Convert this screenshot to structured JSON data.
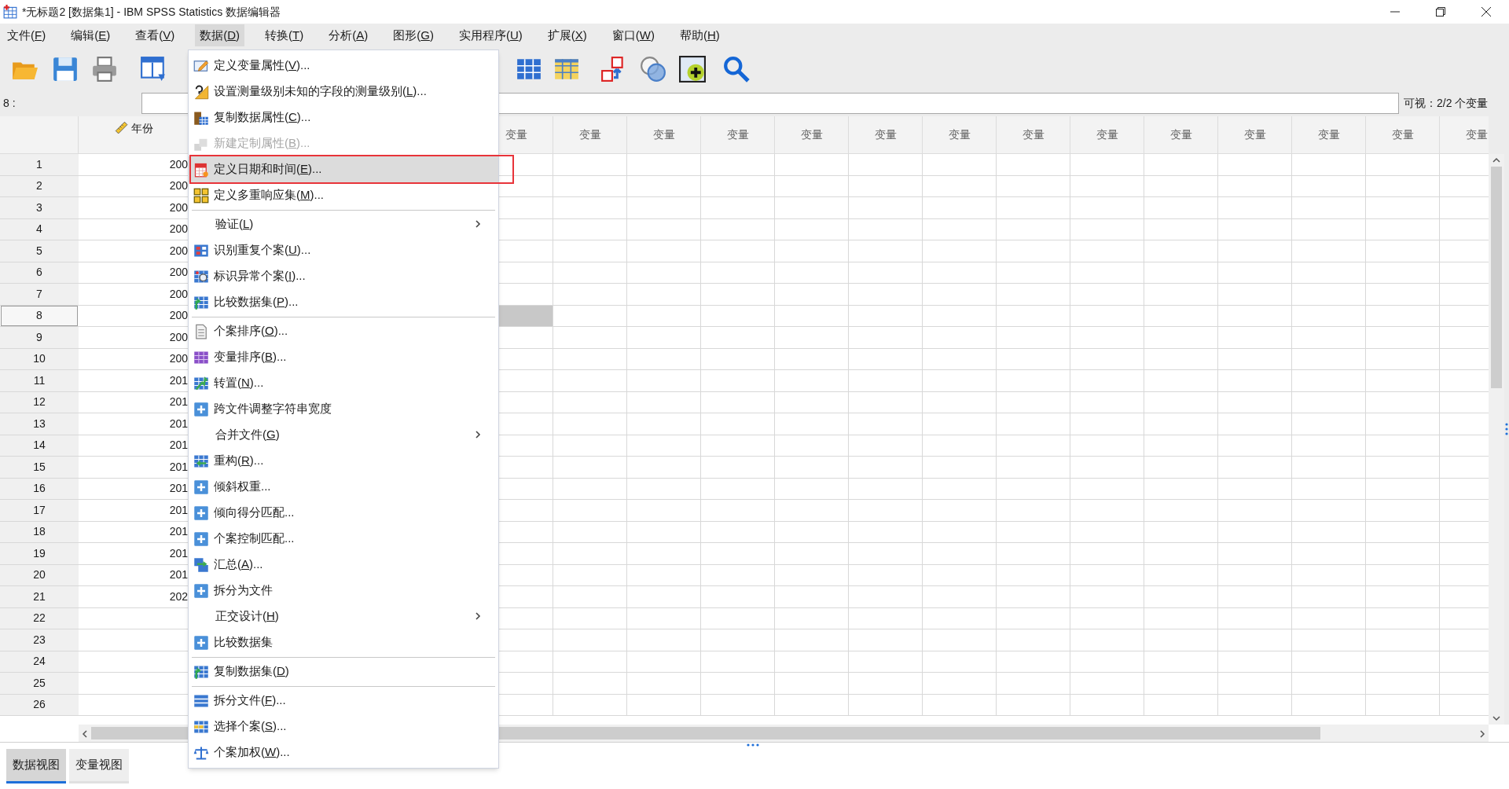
{
  "window": {
    "title": "*无标题2 [数据集1] - IBM SPSS Statistics 数据编辑器"
  },
  "menu_bar": [
    {
      "label": "文件(F)",
      "selected": false
    },
    {
      "label": "编辑(E)",
      "selected": false
    },
    {
      "label": "查看(V)",
      "selected": false
    },
    {
      "label": "数据(D)",
      "selected": true
    },
    {
      "label": "转换(T)",
      "selected": false
    },
    {
      "label": "分析(A)",
      "selected": false
    },
    {
      "label": "图形(G)",
      "selected": false
    },
    {
      "label": "实用程序(U)",
      "selected": false
    },
    {
      "label": "扩展(X)",
      "selected": false
    },
    {
      "label": "窗口(W)",
      "selected": false
    },
    {
      "label": "帮助(H)",
      "selected": false
    }
  ],
  "cell_editor": {
    "row_label": "8 :",
    "visible_count": "可视：2/2 个变量"
  },
  "grid": {
    "year_column": "年份",
    "variable_columns": [
      "变量",
      "变量",
      "变量",
      "变量",
      "变量",
      "变量",
      "变量",
      "变量",
      "变量",
      "变量",
      "变量",
      "变量",
      "变量",
      "变量"
    ],
    "rows": [
      {
        "number": "1",
        "year": "200",
        "selected": false
      },
      {
        "number": "2",
        "year": "200",
        "selected": false
      },
      {
        "number": "3",
        "year": "200",
        "selected": false
      },
      {
        "number": "4",
        "year": "200",
        "selected": false
      },
      {
        "number": "5",
        "year": "200",
        "selected": false
      },
      {
        "number": "6",
        "year": "200",
        "selected": false
      },
      {
        "number": "7",
        "year": "200",
        "selected": false
      },
      {
        "number": "8",
        "year": "200",
        "selected": true
      },
      {
        "number": "9",
        "year": "200",
        "selected": false
      },
      {
        "number": "10",
        "year": "200",
        "selected": false
      },
      {
        "number": "11",
        "year": "201",
        "selected": false
      },
      {
        "number": "12",
        "year": "201",
        "selected": false
      },
      {
        "number": "13",
        "year": "201",
        "selected": false
      },
      {
        "number": "14",
        "year": "201",
        "selected": false
      },
      {
        "number": "15",
        "year": "201",
        "selected": false
      },
      {
        "number": "16",
        "year": "201",
        "selected": false
      },
      {
        "number": "17",
        "year": "201",
        "selected": false
      },
      {
        "number": "18",
        "year": "201",
        "selected": false
      },
      {
        "number": "19",
        "year": "201",
        "selected": false
      },
      {
        "number": "20",
        "year": "201",
        "selected": false
      },
      {
        "number": "21",
        "year": "202",
        "selected": false
      },
      {
        "number": "22",
        "selected": false
      },
      {
        "number": "23",
        "selected": false
      },
      {
        "number": "24",
        "selected": false
      },
      {
        "number": "25",
        "selected": false
      },
      {
        "number": "26",
        "selected": false
      }
    ]
  },
  "data_menu": {
    "items": [
      {
        "kind": "item",
        "label": "定义变量属性(V)...",
        "selected": false,
        "disabled": false,
        "submenu": false,
        "framed": false
      },
      {
        "kind": "item",
        "label": "设置测量级别未知的字段的测量级别(L)...",
        "selected": false,
        "disabled": false,
        "submenu": false,
        "framed": false
      },
      {
        "kind": "item",
        "label": "复制数据属性(C)...",
        "selected": false,
        "disabled": false,
        "submenu": false,
        "framed": false
      },
      {
        "kind": "item",
        "label": "新建定制属性(B)...",
        "selected": false,
        "disabled": true,
        "submenu": false,
        "framed": false
      },
      {
        "kind": "item",
        "label": "定义日期和时间(E)...",
        "selected": true,
        "disabled": false,
        "submenu": false,
        "framed": true
      },
      {
        "kind": "item",
        "label": "定义多重响应集(M)...",
        "selected": false,
        "disabled": false,
        "submenu": false,
        "framed": false
      },
      {
        "kind": "separator"
      },
      {
        "kind": "item",
        "label": "验证(L)",
        "selected": false,
        "disabled": false,
        "submenu": true,
        "framed": false
      },
      {
        "kind": "item",
        "label": "识别重复个案(U)...",
        "selected": false,
        "disabled": false,
        "submenu": false,
        "framed": false
      },
      {
        "kind": "item",
        "label": "标识异常个案(I)...",
        "selected": false,
        "disabled": false,
        "submenu": false,
        "framed": false
      },
      {
        "kind": "item",
        "label": "比较数据集(P)...",
        "selected": false,
        "disabled": false,
        "submenu": false,
        "framed": false
      },
      {
        "kind": "separator"
      },
      {
        "kind": "item",
        "label": "个案排序(O)...",
        "selected": false,
        "disabled": false,
        "submenu": false,
        "framed": false
      },
      {
        "kind": "item",
        "label": "变量排序(B)...",
        "selected": false,
        "disabled": false,
        "submenu": false,
        "framed": false
      },
      {
        "kind": "item",
        "label": "转置(N)...",
        "selected": false,
        "disabled": false,
        "submenu": false,
        "framed": false
      },
      {
        "kind": "item",
        "label": "跨文件调整字符串宽度",
        "selected": false,
        "disabled": false,
        "submenu": false,
        "framed": false
      },
      {
        "kind": "item",
        "label": "合并文件(G)",
        "selected": false,
        "disabled": false,
        "submenu": true,
        "framed": false
      },
      {
        "kind": "item",
        "label": "重构(R)...",
        "selected": false,
        "disabled": false,
        "submenu": false,
        "framed": false
      },
      {
        "kind": "item",
        "label": "倾斜权重...",
        "selected": false,
        "disabled": false,
        "submenu": false,
        "framed": false
      },
      {
        "kind": "item",
        "label": "倾向得分匹配...",
        "selected": false,
        "disabled": false,
        "submenu": false,
        "framed": false
      },
      {
        "kind": "item",
        "label": "个案控制匹配...",
        "selected": false,
        "disabled": false,
        "submenu": false,
        "framed": false
      },
      {
        "kind": "item",
        "label": "汇总(A)...",
        "selected": false,
        "disabled": false,
        "submenu": false,
        "framed": false
      },
      {
        "kind": "item",
        "label": "拆分为文件",
        "selected": false,
        "disabled": false,
        "submenu": false,
        "framed": false
      },
      {
        "kind": "item",
        "label": "正交设计(H)",
        "selected": false,
        "disabled": false,
        "submenu": true,
        "framed": false
      },
      {
        "kind": "item",
        "label": "比较数据集",
        "selected": false,
        "disabled": false,
        "submenu": false,
        "framed": false
      },
      {
        "kind": "separator"
      },
      {
        "kind": "item",
        "label": "复制数据集(D)",
        "selected": false,
        "disabled": false,
        "submenu": false,
        "framed": false
      },
      {
        "kind": "separator"
      },
      {
        "kind": "item",
        "label": "拆分文件(F)...",
        "selected": false,
        "disabled": false,
        "submenu": false,
        "framed": false
      },
      {
        "kind": "item",
        "label": "选择个案(S)...",
        "selected": false,
        "disabled": false,
        "submenu": false,
        "framed": false
      },
      {
        "kind": "item",
        "label": "个案加权(W)...",
        "selected": false,
        "disabled": false,
        "submenu": false,
        "framed": false
      }
    ]
  },
  "view_tabs": [
    {
      "label": "数据视图",
      "selected": true
    },
    {
      "label": "变量视图",
      "selected": false
    }
  ]
}
